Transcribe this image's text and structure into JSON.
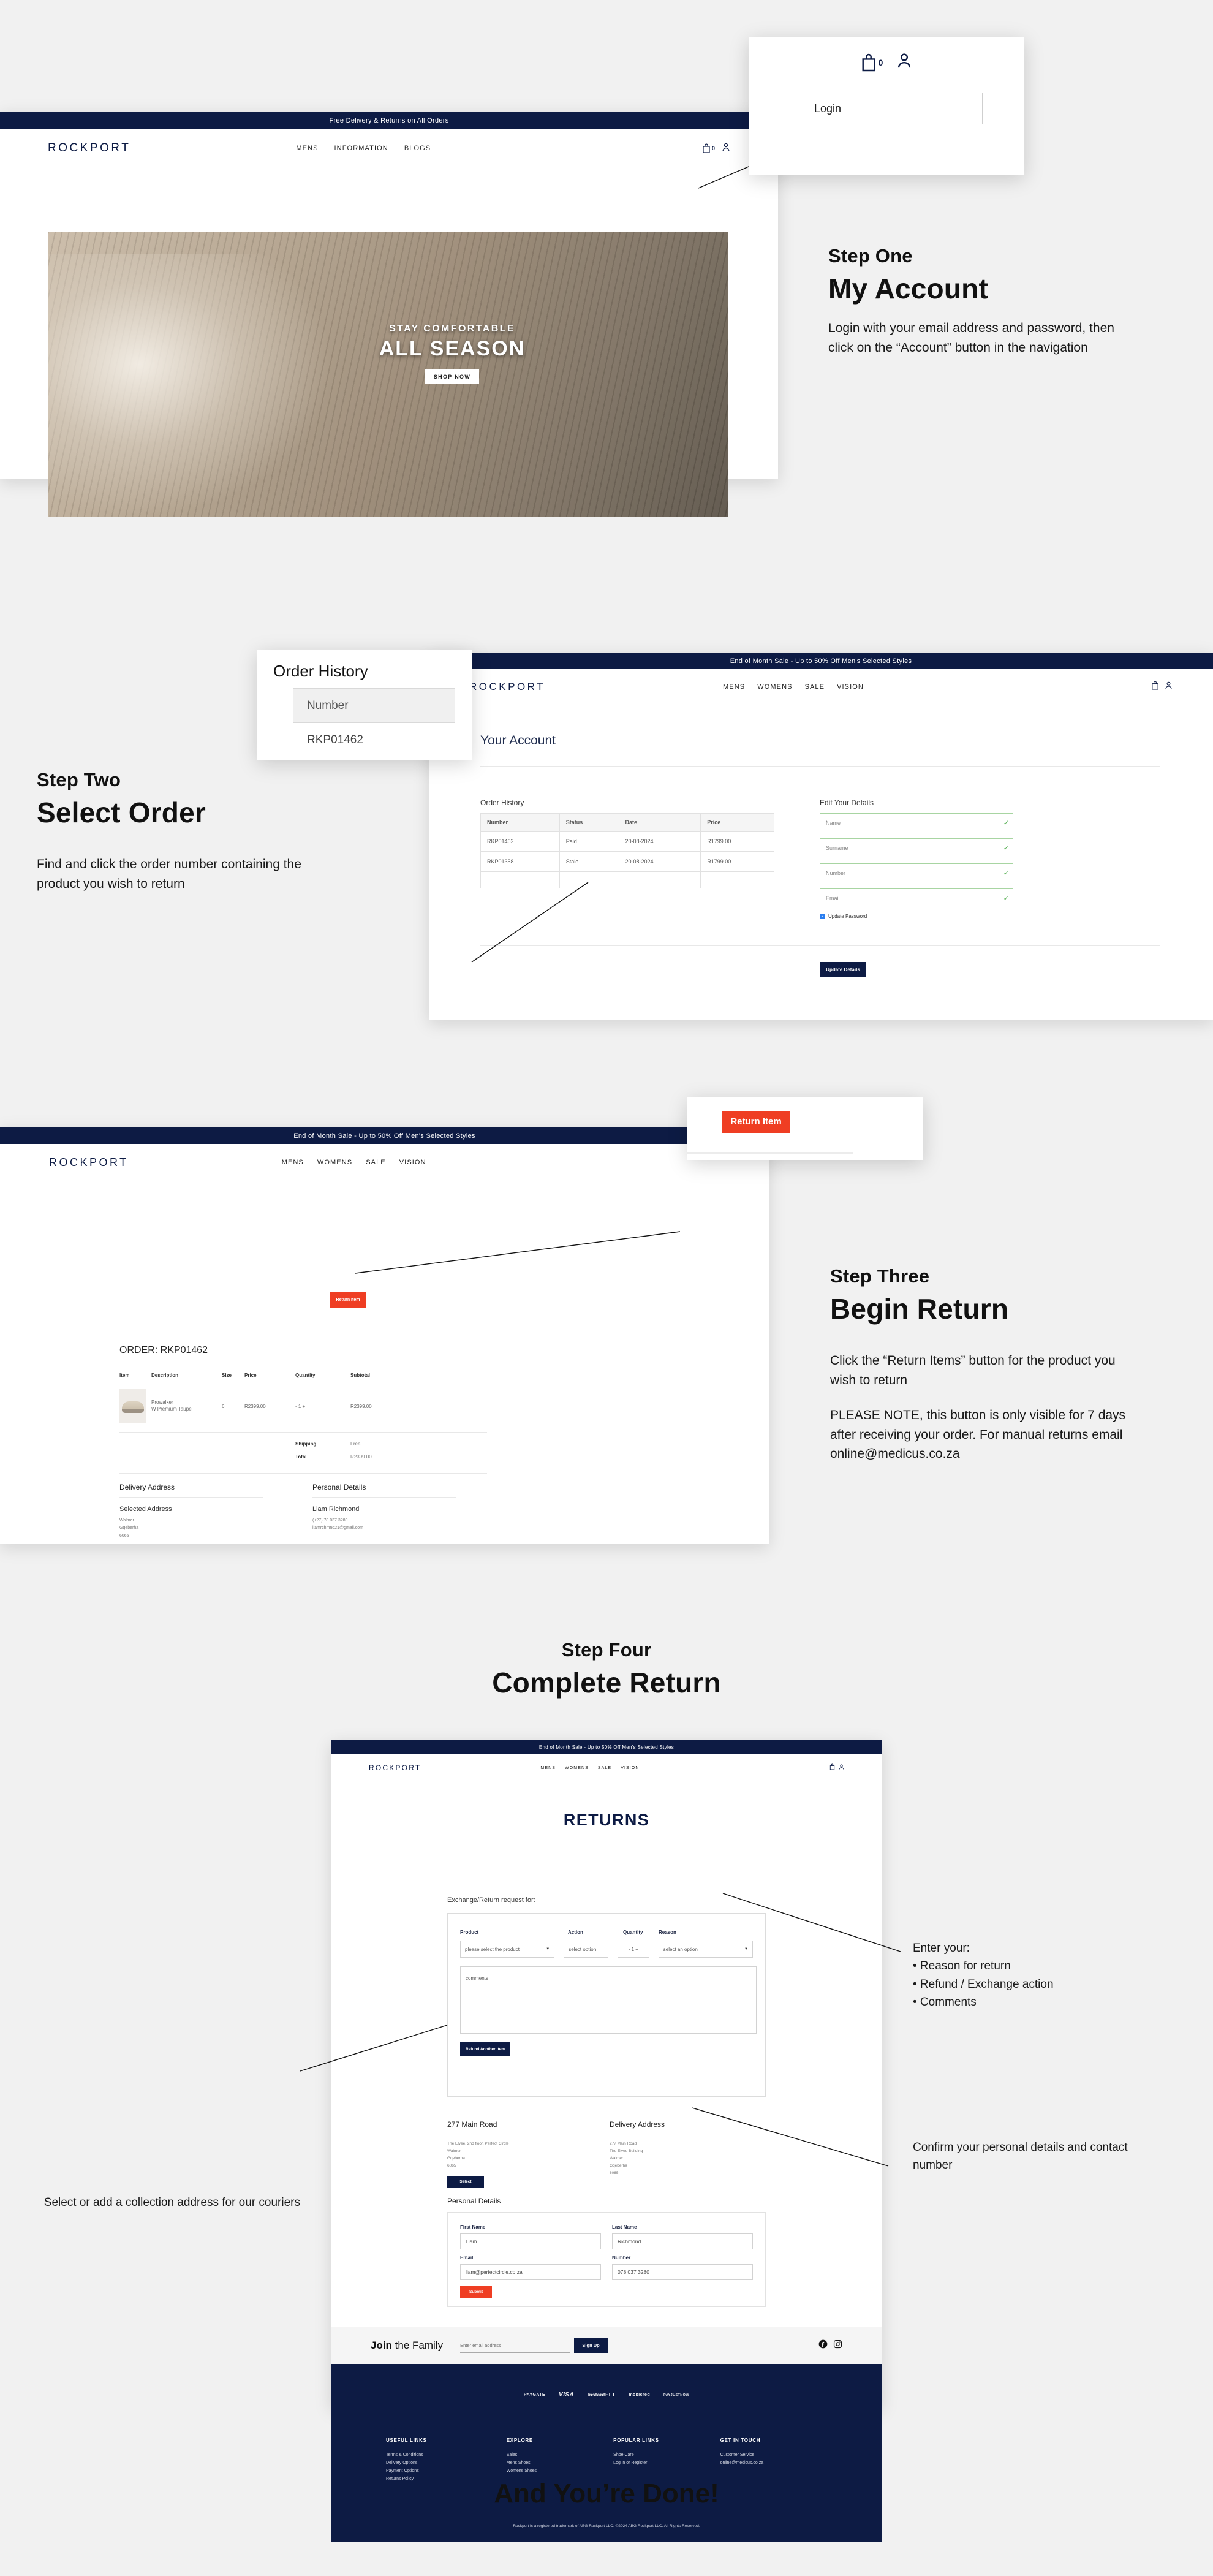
{
  "page": {
    "background": "#f1f1f1",
    "accent_navy": "#0d1b44",
    "accent_red": "#ef3e23"
  },
  "step_one": {
    "kicker": "Step One",
    "title": "My Account",
    "body": "Login with your email address and password, then click on the “Account” button in the navigation",
    "callout": {
      "login_label": "Login",
      "cart_count": "0"
    },
    "site": {
      "promo": "Free Delivery & Returns on All Orders",
      "brand": "ROCKPORT",
      "nav": [
        "MENS",
        "INFORMATION",
        "BLOGS"
      ],
      "cart_count": "0",
      "hero": {
        "sub": "STAY COMFORTABLE",
        "main": "ALL SEASON",
        "button": "SHOP NOW"
      }
    }
  },
  "step_two": {
    "kicker": "Step Two",
    "title": "Select Order",
    "body": "Find and click the order number containing the product you wish to return",
    "callout": {
      "title": "Order History",
      "header": "Number",
      "row": "RKP01462"
    },
    "site": {
      "promo": "End of Month Sale - Up to 50% Off Men's Selected Styles",
      "brand": "ROCKPORT",
      "nav": [
        "MENS",
        "WOMENS",
        "SALE",
        "VISION"
      ],
      "page_title": "Your Account",
      "order_history_label": "Order History",
      "order_columns": [
        "Number",
        "Status",
        "Date",
        "Price"
      ],
      "orders": [
        [
          "RKP01462",
          "Paid",
          "20-08-2024",
          "R1799.00"
        ],
        [
          "RKP01358",
          "Stale",
          "20-08-2024",
          "R1799.00"
        ]
      ],
      "edit_details_label": "Edit Your Details",
      "fields": [
        "Name",
        "Surname",
        "Number",
        "Email"
      ],
      "checkbox_label": "Update Password",
      "submit_label": "Update Details"
    }
  },
  "step_three": {
    "kicker": "Step Three",
    "title": "Begin Return",
    "body_1": "Click the “Return Items” button for the product you wish to return",
    "body_2": "PLEASE NOTE, this button is only visible for 7 days after receiving your order. For manual returns email online@medicus.co.za",
    "callout": {
      "button_label": "Return Item"
    },
    "site": {
      "promo": "End of Month Sale - Up to 50% Off Men's Selected Styles",
      "brand": "ROCKPORT",
      "nav": [
        "MENS",
        "WOMENS",
        "SALE",
        "VISION"
      ],
      "return_button": "Return Item",
      "order_title": "ORDER: RKP01462",
      "columns": [
        "Item",
        "Description",
        "Size",
        "Price",
        "Quantity",
        "Subtotal"
      ],
      "line_item": {
        "name": "Prowalker",
        "variant": "W Premium Taupe",
        "size": "6",
        "price": "R2399.00",
        "quantity": "- 1 +",
        "subtotal": "R2399.00"
      },
      "shipping_label": "Shipping",
      "shipping_value": "Free",
      "total_label": "Total",
      "total_value": "R2399.00",
      "delivery_heading": "Delivery Address",
      "delivery_sub": "Selected Address",
      "delivery_lines": [
        "Walmer",
        "Gqeberha",
        "6065"
      ],
      "personal_heading": "Personal Details",
      "personal_name": "Liam Richmond",
      "personal_lines": [
        "(+27) 78 037 3280",
        "liamrchmnd21@gmail.com"
      ]
    }
  },
  "step_four": {
    "kicker": "Step Four",
    "title": "Complete Return",
    "closing": "And You’re Done!",
    "annotation_right_top": "Enter your:\n• Reason for return\n• Refund / Exchange action\n• Comments",
    "annotation_left": "Select or add a collection address for our couriers",
    "annotation_right_bottom": "Confirm your personal details and contact number",
    "site": {
      "promo": "End of Month Sale - Up to 50% Off Men's Selected Styles",
      "brand": "ROCKPORT",
      "nav": [
        "MENS",
        "WOMENS",
        "SALE",
        "VISION"
      ],
      "page_title": "RETURNS",
      "request_label": "Exchange/Return request for:",
      "form_labels": [
        "Product",
        "Action",
        "Quantity",
        "Reason"
      ],
      "product_select": "please select the product",
      "action_select": "select option",
      "quantity_value": "- 1 +",
      "reason_select": "select an option",
      "comments_placeholder": "comments",
      "refund_another_label": "Refund Another Item",
      "address_heading": "277 Main Road",
      "address_lines": [
        "The Elvee, 2nd floor, Perfect Circle",
        "Walmer",
        "Gqeberha",
        "6065"
      ],
      "select_button": "Select",
      "delivery_heading": "Delivery Address",
      "delivery_lines": [
        "277 Main Road",
        "The Elvee Building",
        "Walmer",
        "Gqeberha",
        "6065"
      ],
      "personal_heading": "Personal Details",
      "personal_fields": [
        {
          "label": "First Name",
          "value": "Liam"
        },
        {
          "label": "Last Name",
          "value": "Richmond"
        },
        {
          "label": "Email",
          "value": "liam@perfectcircle.co.za"
        },
        {
          "label": "Number",
          "value": "078 037 3280"
        }
      ],
      "submit_label": "Submit",
      "newsletter": {
        "title_bold": "Join",
        "title_rest": " the Family",
        "placeholder": "Enter email address",
        "button": "Sign Up"
      },
      "payment_logos": [
        "PAYGATE",
        "VISA",
        "InstantEFT",
        "mobicred",
        "PAYJUSTNOW"
      ],
      "footer_cols": [
        {
          "heading": "USEFUL LINKS",
          "items": [
            "Terms & Conditions",
            "Delivery Options",
            "Payment Options",
            "Returns Policy"
          ]
        },
        {
          "heading": "EXPLORE",
          "items": [
            "Sales",
            "Mens Shoes",
            "Womens Shoes"
          ]
        },
        {
          "heading": "POPULAR LINKS",
          "items": [
            "Shoe Care",
            "Log in or Register"
          ]
        },
        {
          "heading": "GET IN TOUCH",
          "items": [
            "Customer Service",
            "online@medicus.co.za"
          ]
        }
      ],
      "copyright": "Rockport is a registered trademark of ABG Rockport LLC. ©2024 ABG Rockport LLC. All Rights Reserved."
    }
  }
}
